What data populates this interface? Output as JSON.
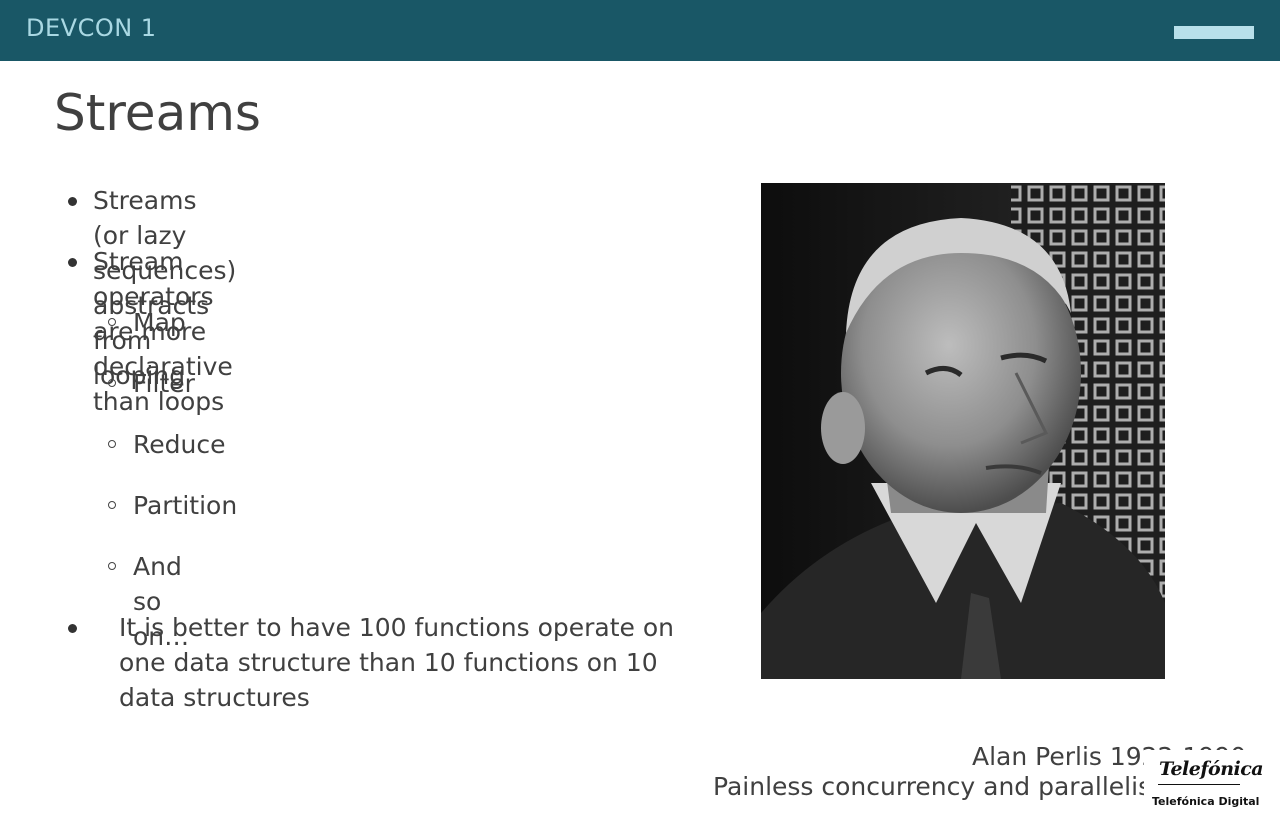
{
  "header": {
    "brand": "DEVCON 1",
    "bar_color": "#195766",
    "accent_color": "#b8e0ea"
  },
  "slide": {
    "title": "Streams",
    "bullets": [
      "Streams (or lazy sequences) abstracts from looping",
      "Stream operators are more declarative than loops"
    ],
    "sub_bullets": [
      "Map",
      "Filter",
      "Reduce",
      "Partition",
      "And so on…"
    ],
    "quote": "It is better to have 100 functions operate on one data structure than 10 functions on 10 data structures",
    "photo": {
      "icon": "portrait-photo"
    },
    "caption": "Alan Perlis 1922-1990",
    "footer_text": "Painless concurrency and parallelism"
  },
  "logo": {
    "script_text": "Telefónica",
    "sub_text": "Telefónica Digital"
  }
}
